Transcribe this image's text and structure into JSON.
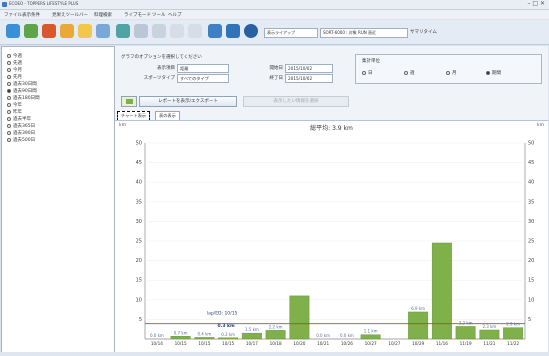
{
  "window": {
    "title": "ECOEO - TOPPERS LIFESTYLE PLUS",
    "controls": "– □ ✕"
  },
  "menu": [
    "ファイル",
    "表示条件",
    "見栄えツールバー",
    "料理検索",
    "ライブモード",
    "ツール",
    "ヘルプ"
  ],
  "toolbar": {
    "select1": "表示ライアップ",
    "select2": "SORT-6000 : 対象 RUN 直近",
    "label3": "サマリタイム"
  },
  "sidebar": {
    "items": [
      {
        "label": "今週",
        "selected": false
      },
      {
        "label": "先週",
        "selected": false
      },
      {
        "label": "今月",
        "selected": false
      },
      {
        "label": "先月",
        "selected": false
      },
      {
        "label": "過去30日間",
        "selected": false
      },
      {
        "label": "過去90日間",
        "selected": true
      },
      {
        "label": "過去180日間",
        "selected": false
      },
      {
        "label": "今年",
        "selected": false
      },
      {
        "label": "昨年",
        "selected": false
      },
      {
        "label": "過去半年",
        "selected": false
      },
      {
        "label": "過去365日",
        "selected": false
      },
      {
        "label": "過去390日",
        "selected": false
      },
      {
        "label": "過去500日",
        "selected": false
      }
    ]
  },
  "options": {
    "title": "グラフのオプションを選択してください",
    "display_item_label": "表示項目",
    "display_item_value": "距離",
    "sport_type_label": "スポーツタイプ",
    "sport_type_value": "すべてのタイプ",
    "start_label": "開始日",
    "start_value": "2015/10/02",
    "end_label": "終了日",
    "end_value": "2015/10/02"
  },
  "unit": {
    "title": "集計単位",
    "options": [
      {
        "label": "日",
        "selected": false
      },
      {
        "label": "週",
        "selected": false
      },
      {
        "label": "月",
        "selected": false
      },
      {
        "label": "期間",
        "selected": true
      }
    ]
  },
  "buttons": {
    "report": "レポートを表示/エクスポート",
    "disabled": "表示したい情報を選択"
  },
  "tabs": [
    {
      "label": "チャート表示",
      "active": true
    },
    {
      "label": "表の表示",
      "active": false
    }
  ],
  "chart_data": {
    "type": "bar",
    "title": "総平均: 3.9 km",
    "ylabel": "km",
    "ylim": [
      0,
      50
    ],
    "yticks": [
      5,
      10,
      15,
      20,
      25,
      30,
      35,
      40,
      45,
      50
    ],
    "categories": [
      "10/14",
      "10/15",
      "10/15",
      "10/15",
      "10/17",
      "10/18",
      "10/20",
      "10/21",
      "10/26",
      "10/27",
      "10/27",
      "10/29",
      "11/16",
      "11/19",
      "11/21",
      "11/22"
    ],
    "values": [
      0.0,
      0.7,
      0.4,
      0.3,
      1.5,
      2.2,
      11.0,
      0.0,
      0.0,
      1.1,
      0.0,
      6.9,
      24.5,
      3.2,
      2.3,
      2.9
    ],
    "data_labels": [
      "0.0 km",
      "0.7 km",
      "0.4 km",
      "0.3 km",
      "1.5 km",
      "2.2 km",
      "",
      "0.0 km",
      "0.0 km",
      "1.1 km",
      "",
      "6.9 km",
      "",
      "3.2 km",
      "2.3 km",
      "2.9 km"
    ],
    "average_line": 3.9,
    "callout": [
      "lap/ED: 10/15",
      "0.3 km"
    ],
    "bar_color": "#7fb04a",
    "avg_line_color": "#a0541f"
  }
}
